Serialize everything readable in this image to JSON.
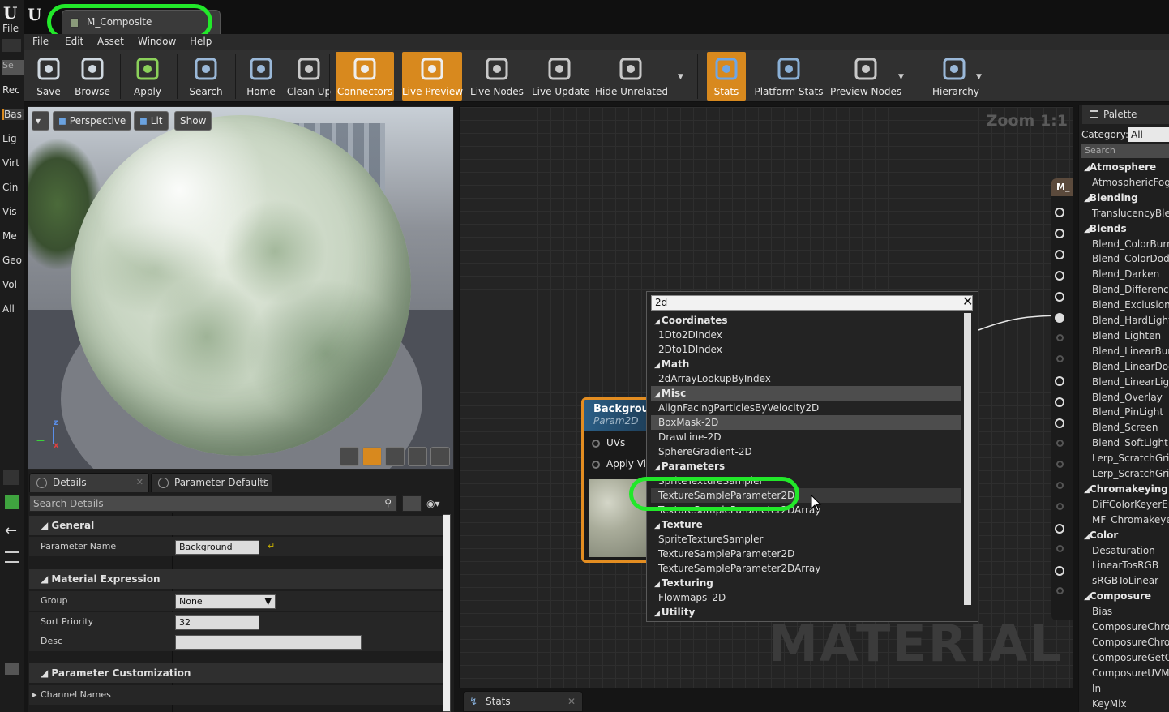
{
  "left_strip": {
    "file_label": "File",
    "search_placeholder": "Se",
    "labels": [
      "Rec",
      "Bas",
      "Lig",
      "Virt",
      "Cin",
      "Vis",
      "Me",
      "Geo",
      "Vol",
      "All"
    ]
  },
  "document_tab": {
    "title": "M_Composite"
  },
  "menu": [
    "File",
    "Edit",
    "Asset",
    "Window",
    "Help"
  ],
  "toolbar": {
    "buttons": [
      {
        "label": "Save",
        "icon": "save-icon"
      },
      {
        "label": "Browse",
        "icon": "browse-icon"
      },
      {
        "label": "Apply",
        "icon": "apply-check-icon"
      },
      {
        "label": "Search",
        "icon": "search-binoculars-icon"
      },
      {
        "label": "Home",
        "icon": "home-icon"
      },
      {
        "label": "Clean Up",
        "icon": "clean-up-icon"
      },
      {
        "label": "Connectors",
        "icon": "connectors-icon",
        "active": true
      },
      {
        "label": "Live Preview",
        "icon": "live-preview-icon",
        "active": true
      },
      {
        "label": "Live Nodes",
        "icon": "live-nodes-icon"
      },
      {
        "label": "Live Update",
        "icon": "live-update-icon"
      },
      {
        "label": "Hide Unrelated",
        "icon": "hide-unrelated-icon"
      },
      {
        "label": "Stats",
        "icon": "stats-icon",
        "active": true
      },
      {
        "label": "Platform Stats",
        "icon": "platform-stats-icon"
      },
      {
        "label": "Preview Nodes",
        "icon": "preview-nodes-icon"
      },
      {
        "label": "Hierarchy",
        "icon": "hierarchy-icon"
      }
    ]
  },
  "viewport": {
    "perspective_label": "Perspective",
    "lit_label": "Lit",
    "show_label": "Show",
    "axis_x": "x",
    "axis_z": "z"
  },
  "details": {
    "tabs": [
      "Details",
      "Parameter Defaults"
    ],
    "search_placeholder": "Search Details",
    "sections": {
      "general": "General",
      "material_expression": "Material Expression",
      "parameter_customization": "Parameter Customization"
    },
    "rows": {
      "parameter_name_label": "Parameter Name",
      "parameter_name_value": "Background",
      "group_label": "Group",
      "group_value": "None",
      "sort_priority_label": "Sort Priority",
      "sort_priority_value": "32",
      "desc_label": "Desc",
      "desc_value": "",
      "channel_names_label": "Channel Names"
    }
  },
  "graph": {
    "zoom_label": "Zoom 1:1",
    "watermark": "MATERIAL",
    "result_node_title": "M_",
    "background_node": {
      "title": "Background",
      "subtitle": "Param2D",
      "pins": [
        "UVs",
        "Apply View"
      ]
    }
  },
  "context_menu": {
    "search_value": "2d",
    "items": [
      {
        "text": "Coordinates",
        "type": "category"
      },
      {
        "text": "1Dto2DIndex",
        "type": "item"
      },
      {
        "text": "2Dto1DIndex",
        "type": "item"
      },
      {
        "text": "Math",
        "type": "category"
      },
      {
        "text": "2dArrayLookupByIndex",
        "type": "item"
      },
      {
        "text": "Misc",
        "type": "category",
        "highlight": "selected"
      },
      {
        "text": "AlignFacingParticlesByVelocity2D",
        "type": "item"
      },
      {
        "text": "BoxMask-2D",
        "type": "item",
        "highlight": "selected"
      },
      {
        "text": "DrawLine-2D",
        "type": "item"
      },
      {
        "text": "SphereGradient-2D",
        "type": "item"
      },
      {
        "text": "Parameters",
        "type": "category"
      },
      {
        "text": "SpriteTextureSampler",
        "type": "item"
      },
      {
        "text": "TextureSampleParameter2D",
        "type": "item",
        "highlight": "hover"
      },
      {
        "text": "TextureSampleParameter2DArray",
        "type": "item"
      },
      {
        "text": "Texture",
        "type": "category"
      },
      {
        "text": "SpriteTextureSampler",
        "type": "item"
      },
      {
        "text": "TextureSampleParameter2D",
        "type": "item"
      },
      {
        "text": "TextureSampleParameter2DArray",
        "type": "item"
      },
      {
        "text": "Texturing",
        "type": "category"
      },
      {
        "text": "Flowmaps_2D",
        "type": "item"
      },
      {
        "text": "Utility",
        "type": "category"
      }
    ]
  },
  "palette": {
    "tab_label": "Palette",
    "category_label": "Category:",
    "category_value": "All",
    "search_placeholder": "Search",
    "items": [
      {
        "text": "Atmosphere",
        "type": "category"
      },
      {
        "text": "AtmosphericFog",
        "type": "item"
      },
      {
        "text": "Blending",
        "type": "category"
      },
      {
        "text": "TranslucencyBle",
        "type": "item"
      },
      {
        "text": "Blends",
        "type": "category"
      },
      {
        "text": "Blend_ColorBurn",
        "type": "item"
      },
      {
        "text": "Blend_ColorDodg",
        "type": "item"
      },
      {
        "text": "Blend_Darken",
        "type": "item"
      },
      {
        "text": "Blend_Difference",
        "type": "item"
      },
      {
        "text": "Blend_Exclusion",
        "type": "item"
      },
      {
        "text": "Blend_HardLight",
        "type": "item"
      },
      {
        "text": "Blend_Lighten",
        "type": "item"
      },
      {
        "text": "Blend_LinearBurn",
        "type": "item"
      },
      {
        "text": "Blend_LinearDod",
        "type": "item"
      },
      {
        "text": "Blend_LinearLigh",
        "type": "item"
      },
      {
        "text": "Blend_Overlay",
        "type": "item"
      },
      {
        "text": "Blend_PinLight",
        "type": "item"
      },
      {
        "text": "Blend_Screen",
        "type": "item"
      },
      {
        "text": "Blend_SoftLight",
        "type": "item"
      },
      {
        "text": "Lerp_ScratchGri",
        "type": "item"
      },
      {
        "text": "Lerp_ScratchGri",
        "type": "item"
      },
      {
        "text": "Chromakeying",
        "type": "category"
      },
      {
        "text": "DiffColorKeyerEr",
        "type": "item"
      },
      {
        "text": "MF_Chromakeye",
        "type": "item"
      },
      {
        "text": "Color",
        "type": "category"
      },
      {
        "text": "Desaturation",
        "type": "item"
      },
      {
        "text": "LinearTosRGB",
        "type": "item"
      },
      {
        "text": "sRGBToLinear",
        "type": "item"
      },
      {
        "text": "Composure",
        "type": "category"
      },
      {
        "text": "Bias",
        "type": "item"
      },
      {
        "text": "ComposureChro",
        "type": "item"
      },
      {
        "text": "ComposureChro",
        "type": "item"
      },
      {
        "text": "ComposureGetCl",
        "type": "item"
      },
      {
        "text": "ComposureUVMa",
        "type": "item"
      },
      {
        "text": "In",
        "type": "item"
      },
      {
        "text": "KeyMix",
        "type": "item"
      }
    ]
  },
  "bottom_tab": {
    "label": "Stats"
  },
  "colors": {
    "accent_orange": "#d8891e",
    "highlight_ring": "#22e82a",
    "node_header_blue": "#2b5f87"
  }
}
